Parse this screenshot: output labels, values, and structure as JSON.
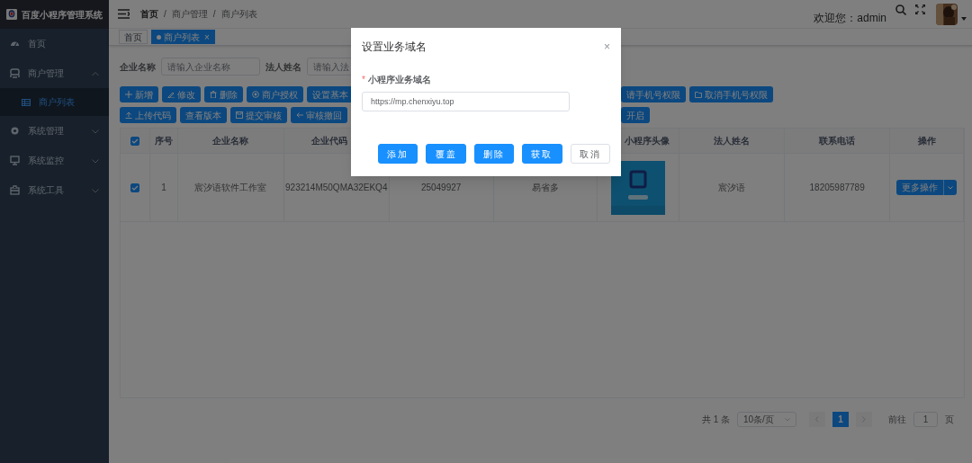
{
  "app": {
    "title": "百度小程序管理系统"
  },
  "sidebar": {
    "items": [
      {
        "label": "首页",
        "selected": false
      },
      {
        "label": "商户管理",
        "expanded": true,
        "selected": false,
        "children": [
          {
            "label": "商户列表",
            "selected": true
          }
        ]
      },
      {
        "label": "系统管理",
        "expanded": false,
        "selected": false
      },
      {
        "label": "系统监控",
        "expanded": false,
        "selected": false
      },
      {
        "label": "系统工具",
        "expanded": false,
        "selected": false
      }
    ]
  },
  "breadcrumb": [
    {
      "label": "首页"
    },
    {
      "separator": "/",
      "label": "商户管理"
    },
    {
      "separator": "/",
      "label": "商户列表"
    }
  ],
  "header": {
    "welcome": "欢迎您：admin"
  },
  "tabs": [
    {
      "label": "首页",
      "selected": false
    },
    {
      "label": "商户列表",
      "selected": true,
      "close": "×"
    }
  ],
  "filters": [
    {
      "label": "企业名称",
      "placeholder": "请输入企业名称"
    },
    {
      "label": "法人姓名",
      "placeholder": "请输入法"
    }
  ],
  "toolbar_rows": [
    [
      {
        "label": "新增"
      },
      {
        "label": "修改"
      },
      {
        "label": "删除"
      },
      {
        "label": "商户授权"
      },
      {
        "label": "设置基本"
      },
      {
        "label": "请手机号权限"
      },
      {
        "label": "取消手机号权限"
      }
    ],
    [
      {
        "label": "上传代码"
      },
      {
        "label": "查看版本"
      },
      {
        "label": "提交审核"
      },
      {
        "label": "审核撤回"
      },
      {
        "label": "开启"
      }
    ]
  ],
  "table": {
    "columns": [
      "",
      "序号",
      "企业名称",
      "企业代码",
      "",
      "",
      "小程序头像",
      "法人姓名",
      "联系电话",
      "操作"
    ],
    "header_checked": true,
    "rows": [
      {
        "checked": true,
        "cells": [
          "",
          "1",
          "宸汐语软件工作室",
          "923214M50QMA32EKQ4",
          "25049927",
          "易省多",
          "",
          "宸汐语",
          "18205987789"
        ],
        "action": "更多操作"
      }
    ]
  },
  "pagination": {
    "total": "共 1 条",
    "page_size": "10条/页",
    "pages": [
      {
        "label": "1",
        "selected": true
      }
    ],
    "goto_label": "前往",
    "goto_value": "1",
    "goto_suffix": "页"
  },
  "dialog": {
    "title": "设置业务域名",
    "close": "×",
    "required_mark": "*",
    "field_label": "小程序业务域名",
    "value": "https://mp.chenxiyu.top",
    "buttons": [
      {
        "label": "添加",
        "kind": "primary"
      },
      {
        "label": "覆盖",
        "kind": "primary"
      },
      {
        "label": "删除",
        "kind": "primary"
      },
      {
        "label": "获取",
        "kind": "primary"
      },
      {
        "label": "取消",
        "kind": "default"
      }
    ]
  }
}
